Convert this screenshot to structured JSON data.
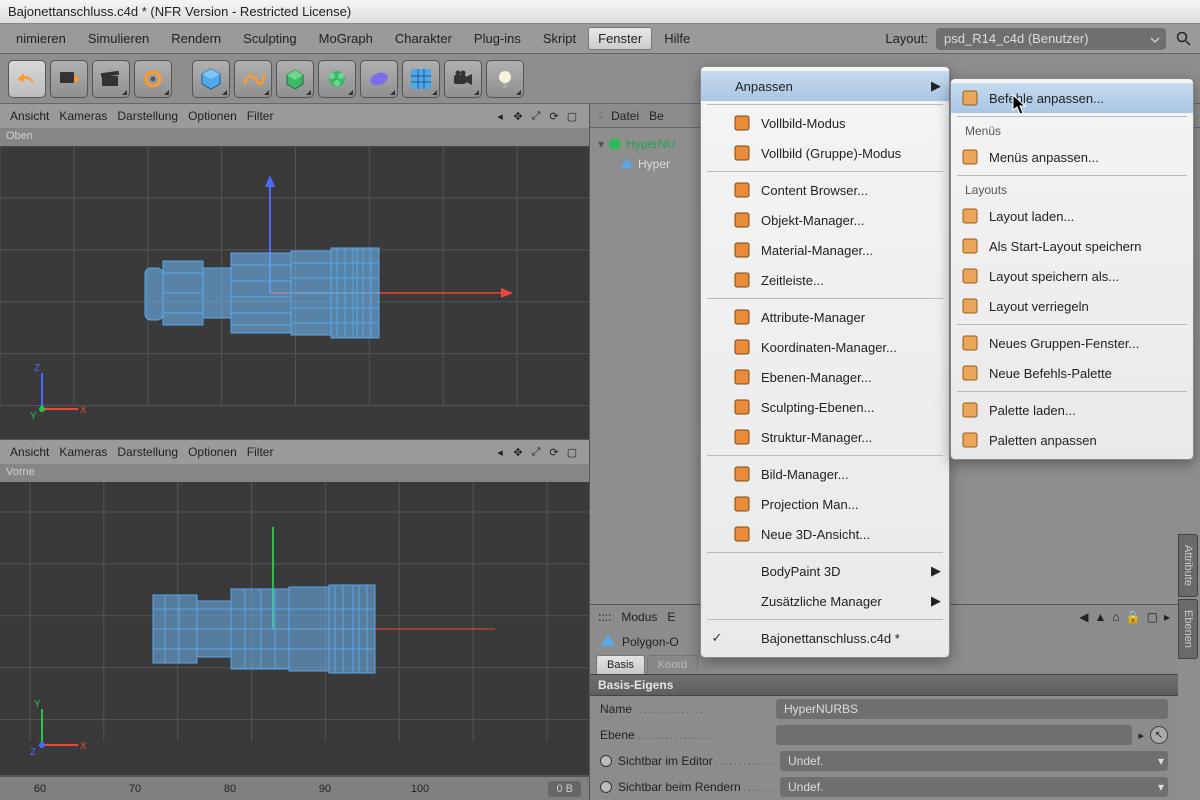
{
  "title": "Bajonettanschluss.c4d * (NFR Version - Restricted License)",
  "menubar": [
    "nimieren",
    "Simulieren",
    "Rendern",
    "Sculpting",
    "MoGraph",
    "Charakter",
    "Plug-ins",
    "Skript",
    "Fenster",
    "Hilfe"
  ],
  "layout_label": "Layout:",
  "layout_value": "psd_R14_c4d (Benutzer)",
  "viewport_menus": [
    "Ansicht",
    "Kameras",
    "Darstellung",
    "Optionen",
    "Filter"
  ],
  "viewports": [
    {
      "label": "Oben",
      "axes": [
        "Z",
        "Y",
        "X"
      ]
    },
    {
      "label": "Vorne",
      "axes": [
        "Y",
        "Z",
        "X"
      ]
    }
  ],
  "ruler_ticks": [
    "60",
    "70",
    "80",
    "90",
    "100"
  ],
  "ruler_field": "0 B",
  "obj_panel_menus": [
    "Datei",
    "Be"
  ],
  "obj_tree": {
    "parent": "HyperNU",
    "child": "Hyper"
  },
  "fenster_menu": {
    "anpassen": "Anpassen",
    "items": [
      {
        "label": "Vollbild-Modus",
        "ico": "square"
      },
      {
        "label": "Vollbild (Gruppe)-Modus",
        "ico": "square"
      },
      {
        "sep": true
      },
      {
        "label": "Content Browser...",
        "ico": "folder"
      },
      {
        "label": "Objekt-Manager...",
        "ico": "obj"
      },
      {
        "label": "Material-Manager...",
        "ico": "mat"
      },
      {
        "label": "Zeitleiste...",
        "ico": "time"
      },
      {
        "sep": true
      },
      {
        "label": "Attribute-Manager",
        "ico": "attr"
      },
      {
        "label": "Koordinaten-Manager...",
        "ico": "coord"
      },
      {
        "label": "Ebenen-Manager...",
        "ico": "layer"
      },
      {
        "label": "Sculpting-Ebenen...",
        "ico": "sculpt"
      },
      {
        "label": "Struktur-Manager...",
        "ico": "struct"
      },
      {
        "sep": true
      },
      {
        "label": "Bild-Manager...",
        "ico": "img"
      },
      {
        "label": "Projection Man...",
        "ico": "proj"
      },
      {
        "label": "Neue 3D-Ansicht...",
        "ico": "view3d"
      },
      {
        "sep": true
      },
      {
        "label": "BodyPaint 3D",
        "submenu": true
      },
      {
        "label": "Zusätzliche Manager",
        "submenu": true
      },
      {
        "sep": true
      },
      {
        "label": "Bajonettanschluss.c4d *",
        "checked": true
      }
    ]
  },
  "anpassen_submenu": [
    {
      "label": "Befehle anpassen...",
      "ico": "cmd",
      "hl": true
    },
    {
      "sep": true
    },
    {
      "hdr": "Menüs"
    },
    {
      "label": "Menüs anpassen...",
      "ico": "menu"
    },
    {
      "sep": true
    },
    {
      "hdr": "Layouts"
    },
    {
      "label": "Layout laden...",
      "ico": "load"
    },
    {
      "label": "Als Start-Layout speichern",
      "ico": "start"
    },
    {
      "label": "Layout speichern als...",
      "ico": "save"
    },
    {
      "label": "Layout verriegeln",
      "ico": "lock"
    },
    {
      "sep": true
    },
    {
      "label": "Neues Gruppen-Fenster...",
      "ico": "grp"
    },
    {
      "label": "Neue Befehls-Palette",
      "ico": "pal"
    },
    {
      "sep": true
    },
    {
      "label": "Palette laden...",
      "ico": "pload"
    },
    {
      "label": "Paletten anpassen",
      "ico": "padj"
    }
  ],
  "attr_menus": [
    "Modus",
    "E"
  ],
  "attr_object_label": "Polygon-O",
  "attr_tabs": [
    "Basis",
    "Koord"
  ],
  "attr_section": "Basis-Eigens",
  "attr_rows": [
    {
      "label": "Name",
      "value": "HyperNURBS",
      "radio": false,
      "plain": true
    },
    {
      "label": "Ebene",
      "value": "",
      "radio": false,
      "extra": true
    },
    {
      "label": "Sichtbar im Editor",
      "value": "Undef.",
      "radio": true
    },
    {
      "label": "Sichtbar beim Rendern",
      "value": "Undef.",
      "radio": true
    }
  ],
  "side_tabs": [
    "Attribute",
    "Ebenen"
  ]
}
